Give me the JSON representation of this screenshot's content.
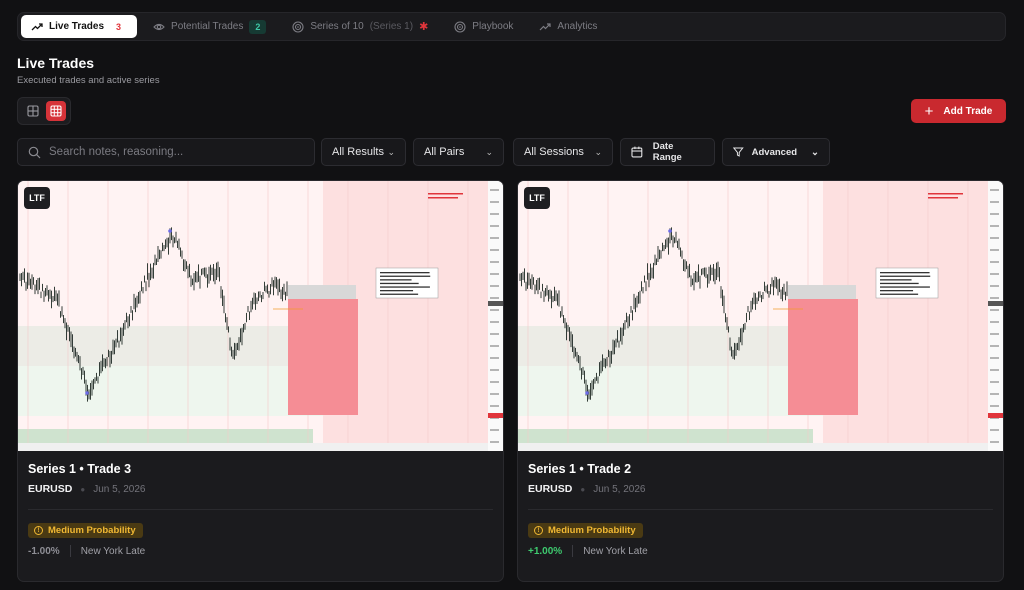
{
  "tabs": [
    {
      "label": "Live Trades",
      "badge": "3",
      "icon": "trending-up-icon",
      "active": true
    },
    {
      "label": "Potential Trades",
      "badge": "2",
      "icon": "eye-icon"
    },
    {
      "label": "Series of 10",
      "sub": "(Series 1)",
      "icon": "target-icon",
      "extra_icon": "sparkle-icon"
    },
    {
      "label": "Playbook",
      "icon": "target-icon"
    },
    {
      "label": "Analytics",
      "icon": "trending-up-icon"
    }
  ],
  "header": {
    "title": "Live Trades",
    "subtitle": "Executed trades and active series"
  },
  "toolbar": {
    "add_label": "Add Trade"
  },
  "filters": {
    "search_placeholder": "Search notes, reasoning...",
    "results": "All Results",
    "pairs": "All Pairs",
    "sessions": "All Sessions",
    "date_range": "Date Range",
    "advanced": "Advanced"
  },
  "colors": {
    "accent": "#c9292f",
    "loss": "#8e8e95",
    "win": "#3ecb6f",
    "warning": "#f0b833"
  },
  "trades": [
    {
      "badge": "LTF",
      "title": "Series 1 • Trade 3",
      "pair": "EURUSD",
      "date": "Jun 5, 2026",
      "probability": "Medium Probability",
      "result": "-1.00%",
      "result_type": "loss",
      "session": "New York Late"
    },
    {
      "badge": "LTF",
      "title": "Series 1 • Trade 2",
      "pair": "EURUSD",
      "date": "Jun 5, 2026",
      "probability": "Medium Probability",
      "result": "+1.00%",
      "result_type": "win",
      "session": "New York Late"
    }
  ]
}
